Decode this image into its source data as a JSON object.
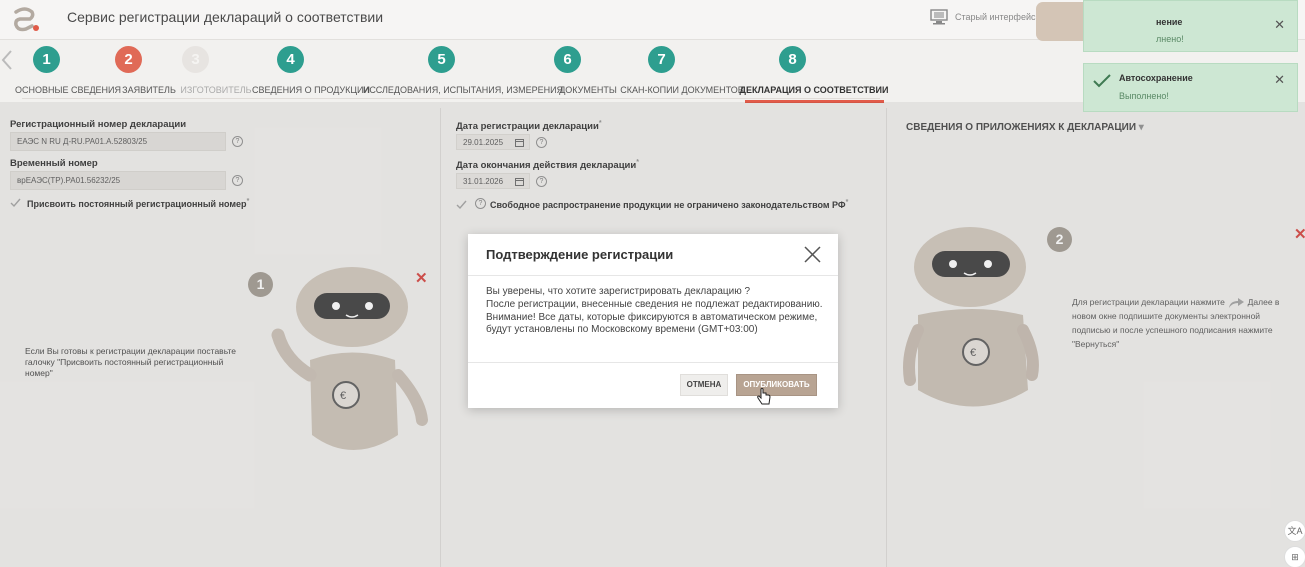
{
  "header": {
    "title": "Сервис регистрации деклараций о соответствии",
    "old_ui_label": "Старый интерфейс"
  },
  "steps": [
    {
      "num": "1",
      "label": "ОСНОВНЫЕ СВЕДЕНИЯ",
      "color": "#2e9e8f"
    },
    {
      "num": "2",
      "label": "ЗАЯВИТЕЛЬ",
      "color": "#e06a57"
    },
    {
      "num": "3",
      "label": "ИЗГОТОВИТЕЛЬ",
      "color": "#e4e1de"
    },
    {
      "num": "4",
      "label": "СВЕДЕНИЯ О ПРОДУКЦИИ",
      "color": "#2e9e8f"
    },
    {
      "num": "5",
      "label": "ИССЛЕДОВАНИЯ, ИСПЫТАНИЯ, ИЗМЕРЕНИЯ",
      "color": "#2e9e8f"
    },
    {
      "num": "6",
      "label": "ДОКУМЕНТЫ",
      "color": "#2e9e8f"
    },
    {
      "num": "7",
      "label": "СКАН-КОПИИ ДОКУМЕНТОВ",
      "color": "#2e9e8f"
    },
    {
      "num": "8",
      "label": "ДЕКЛАРАЦИЯ О СООТВЕТСТВИИ",
      "color": "#2e9e8f"
    }
  ],
  "left": {
    "reg_label": "Регистрационный номер декларации",
    "reg_value": "ЕАЭС N RU Д-RU.РА01.А.52803/25",
    "temp_label": "Временный номер",
    "temp_value": "врЕАЭС(ТР).РА01.56232/25",
    "assign_label": "Присвоить постоянный регистрационный номер",
    "hint_num": "1",
    "hint": "Если Вы готовы к регистрации декларации поставьте галочку \"Присвоить постоянный регистрационный номер\""
  },
  "middle": {
    "reg_date_label": "Дата регистрации декларации",
    "reg_date_value": "29.01.2025",
    "end_date_label": "Дата окончания действия декларации",
    "end_date_value": "31.01.2026",
    "free_dist_label": "Свободное распространение продукции не ограничено законодательством РФ"
  },
  "right": {
    "apps_title": "СВЕДЕНИЯ О ПРИЛОЖЕНИЯХ К ДЕКЛАРАЦИИ",
    "hint_num": "2",
    "hint_a": "Для регистрации декларации нажмите",
    "hint_b": "Далее в новом окне подпишите документы электронной подписью и после успешного подписания нажмите \"Вернуться\""
  },
  "toasts": [
    {
      "title": "нение",
      "msg": "лнено!"
    },
    {
      "title": "Автосохранение",
      "msg": "Выполнено!"
    }
  ],
  "modal": {
    "title": "Подтверждение регистрации",
    "line1": "Вы уверены, что хотите зарегистрировать декларацию ?",
    "line2": "После регистрации, внесенные сведения не подлежат редактированию.",
    "line3": "Внимание! Все даты, которые фиксируются в автоматическом режиме, будут установлены по Московскому времени (GMT+03:00)",
    "cancel": "ОТМЕНА",
    "publish": "ОПУБЛИКОВАТЬ"
  },
  "corner": {
    "translate": "文A",
    "apps": "⊞"
  }
}
